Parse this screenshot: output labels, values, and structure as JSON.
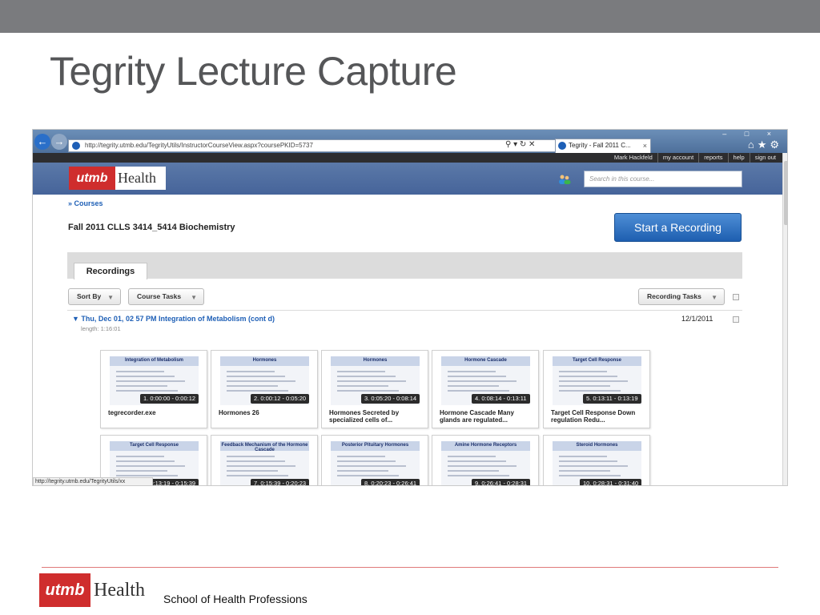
{
  "slide": {
    "title": "Tegrity Lecture Capture",
    "footer_logo_utmb": "utmb",
    "footer_logo_health": "Health",
    "footer_text": "School of Health Professions"
  },
  "browser": {
    "url": "http://tegrity.utmb.edu/TegrityUtils/InstructorCourseView.aspx?coursePKID=5737",
    "tab_title": "Tegrity - Fall 2011 C...",
    "tab_close": "×",
    "window_controls": "– □ ×",
    "status_url": "http://tegrity.utmb.edu/TegrityUtils/xx"
  },
  "userbar": {
    "links": [
      "Mark Hackfeld",
      "my account",
      "reports",
      "help",
      "sign out"
    ]
  },
  "header": {
    "logo_utmb": "utmb",
    "logo_health": "Health",
    "search_placeholder": "Search in this course..."
  },
  "page": {
    "breadcrumb": "» Courses",
    "course_title": "Fall 2011 CLLS 3414_5414 Biochemistry",
    "start_recording": "Start a Recording",
    "recordings_tab": "Recordings",
    "sort_by": "Sort By",
    "course_tasks": "Course Tasks",
    "recording_tasks": "Recording Tasks",
    "session": {
      "title": "Thu, Dec 01, 02 57 PM Integration of Metabolism (cont d)",
      "length": "length: 1:16:01",
      "date": "12/1/2011"
    },
    "thumbnails_row1": [
      {
        "time": "1. 0:00:00 - 0:00:12",
        "caption": "tegrecorder.exe",
        "heading": "Integration of Metabolism"
      },
      {
        "time": "2. 0:00:12 - 0:05:20",
        "caption": "Hormones 26",
        "heading": "Hormones"
      },
      {
        "time": "3. 0:05:20 - 0:08:14",
        "caption": "Hormones Secreted by specialized cells of...",
        "heading": "Hormones"
      },
      {
        "time": "4. 0:08:14 - 0:13:11",
        "caption": "Hormone Cascade Many glands are regulated...",
        "heading": "Hormone Cascade"
      },
      {
        "time": "5. 0:13:11 - 0:13:19",
        "caption": "Target Cell Response Down regulation Redu...",
        "heading": "Target Cell Response"
      }
    ],
    "thumbnails_row2": [
      {
        "time": "6. 0:13:19 - 0:15:39",
        "heading": "Target Cell Response"
      },
      {
        "time": "7. 0:15:39 - 0:20:23",
        "heading": "Feedback Mechanism of the Hormone Cascade"
      },
      {
        "time": "8. 0:20:23 - 0:26:41",
        "heading": "Posterior Pituitary Hormones"
      },
      {
        "time": "9. 0:26:41 - 0:28:31",
        "heading": "Amine Hormone Receptors"
      },
      {
        "time": "10. 0:28:31 - 0:31:40",
        "heading": "Steroid Hormones"
      }
    ]
  },
  "colors": {
    "top_band": "#7a7b7e",
    "title_gray": "#555658",
    "utmb_red": "#cf2d2d",
    "link_blue": "#1e5fb6",
    "header_blue": "#5b79a8",
    "button_blue": "#2a6fc9"
  },
  "icons": {
    "back": "arrow-left-icon",
    "forward": "arrow-right-icon",
    "home": "home-icon",
    "favorites": "star-icon",
    "settings": "gear-icon",
    "search_tools": "search-icon",
    "people": "people-icon",
    "caret": "caret-down-icon"
  }
}
